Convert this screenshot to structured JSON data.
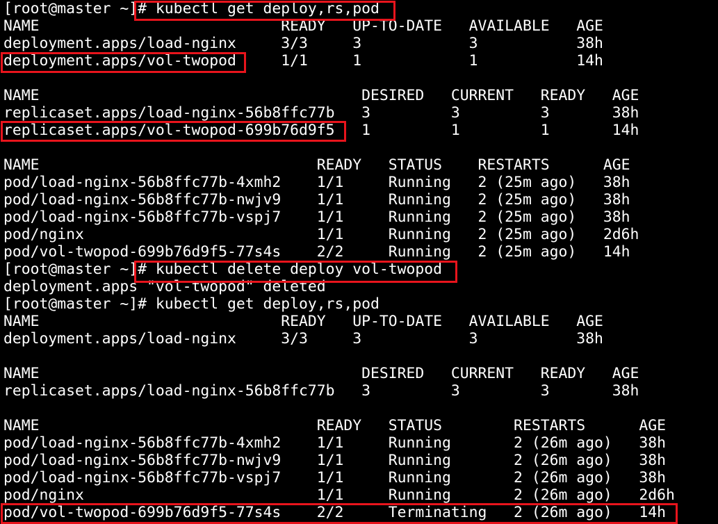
{
  "terminal": {
    "lines": [
      "[root@master ~]# kubectl get deploy,rs,pod",
      "NAME                           READY   UP-TO-DATE   AVAILABLE   AGE",
      "deployment.apps/load-nginx     3/3     3            3           38h",
      "deployment.apps/vol-twopod     1/1     1            1           14h",
      "",
      "NAME                                    DESIRED   CURRENT   READY   AGE",
      "replicaset.apps/load-nginx-56b8ffc77b   3         3         3       38h",
      "replicaset.apps/vol-twopod-699b76d9f5   1         1         1       14h",
      "",
      "NAME                               READY   STATUS    RESTARTS      AGE",
      "pod/load-nginx-56b8ffc77b-4xmh2    1/1     Running   2 (25m ago)   38h",
      "pod/load-nginx-56b8ffc77b-nwjv9    1/1     Running   2 (25m ago)   38h",
      "pod/load-nginx-56b8ffc77b-vspj7    1/1     Running   2 (25m ago)   38h",
      "pod/nginx                          1/1     Running   2 (25m ago)   2d6h",
      "pod/vol-twopod-699b76d9f5-77s4s    2/2     Running   2 (25m ago)   14h",
      "[root@master ~]# kubectl delete deploy vol-twopod",
      "deployment.apps \"vol-twopod\" deleted",
      "[root@master ~]# kubectl get deploy,rs,pod",
      "NAME                           READY   UP-TO-DATE   AVAILABLE   AGE",
      "deployment.apps/load-nginx     3/3     3            3           38h",
      "",
      "NAME                                    DESIRED   CURRENT   READY   AGE",
      "replicaset.apps/load-nginx-56b8ffc77b   3         3         3       38h",
      "",
      "NAME                               READY   STATUS        RESTARTS      AGE",
      "pod/load-nginx-56b8ffc77b-4xmh2    1/1     Running       2 (26m ago)   38h",
      "pod/load-nginx-56b8ffc77b-nwjv9    1/1     Running       2 (26m ago)   38h",
      "pod/load-nginx-56b8ffc77b-vspj7    1/1     Running       2 (26m ago)   38h",
      "pod/nginx                          1/1     Running       2 (26m ago)   2d6h",
      "pod/vol-twopod-699b76d9f5-77s4s    2/2     Terminating   2 (26m ago)   14h"
    ]
  },
  "colors": {
    "background": "#000000",
    "text": "#ffffff",
    "highlight": "#e8141c"
  }
}
